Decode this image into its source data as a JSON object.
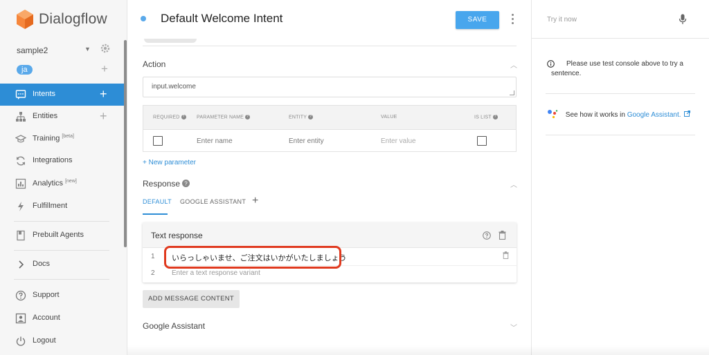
{
  "app": {
    "brand": "Dialogflow",
    "agent_name": "sample2",
    "language": "ja"
  },
  "colors": {
    "accent": "#2d8dd6",
    "save_button": "#48a6ed",
    "highlight": "#e0391e",
    "logo_orange": "#f6863b"
  },
  "sidebar": {
    "items": [
      {
        "label": "Intents",
        "icon": "chat-bubble-icon",
        "active": true,
        "plus": true
      },
      {
        "label": "Entities",
        "icon": "hierarchy-icon",
        "plus": true
      },
      {
        "label": "Training",
        "sup": "[beta]",
        "icon": "graduation-cap-icon"
      },
      {
        "label": "Integrations",
        "icon": "sync-icon"
      },
      {
        "label": "Analytics",
        "sup": "[new]",
        "icon": "bar-chart-icon"
      },
      {
        "label": "Fulfillment",
        "icon": "lightning-icon"
      },
      {
        "label": "Prebuilt Agents",
        "icon": "book-icon"
      },
      {
        "label": "Docs",
        "icon": "chevron-right-icon"
      },
      {
        "label": "Support",
        "icon": "question-circle-icon"
      },
      {
        "label": "Account",
        "icon": "person-icon"
      },
      {
        "label": "Logout",
        "icon": "power-icon"
      }
    ]
  },
  "header": {
    "title": "Default Welcome Intent",
    "save_label": "SAVE"
  },
  "action": {
    "title": "Action",
    "value": "input.welcome"
  },
  "params": {
    "headers": [
      "REQUIRED",
      "PARAMETER NAME",
      "ENTITY",
      "VALUE",
      "IS LIST"
    ],
    "name_placeholder": "Enter name",
    "entity_placeholder": "Enter entity",
    "value_placeholder": "Enter value",
    "new_parameter": "+ New parameter"
  },
  "response": {
    "title": "Response",
    "tabs": [
      "DEFAULT",
      "GOOGLE ASSISTANT"
    ],
    "card_title": "Text response",
    "rows": [
      {
        "num": "1",
        "text": "いらっしゃいませ、ご注文はいかがいたしましょう"
      },
      {
        "num": "2",
        "placeholder": "Enter a text response variant"
      }
    ],
    "add_message": "ADD MESSAGE CONTENT"
  },
  "google_assistant": {
    "title": "Google Assistant"
  },
  "right_panel": {
    "try_it": "Try it now",
    "info": "Please use test console above to try a sentence.",
    "see_how": "See how it works in ",
    "ga_link": "Google Assistant."
  }
}
